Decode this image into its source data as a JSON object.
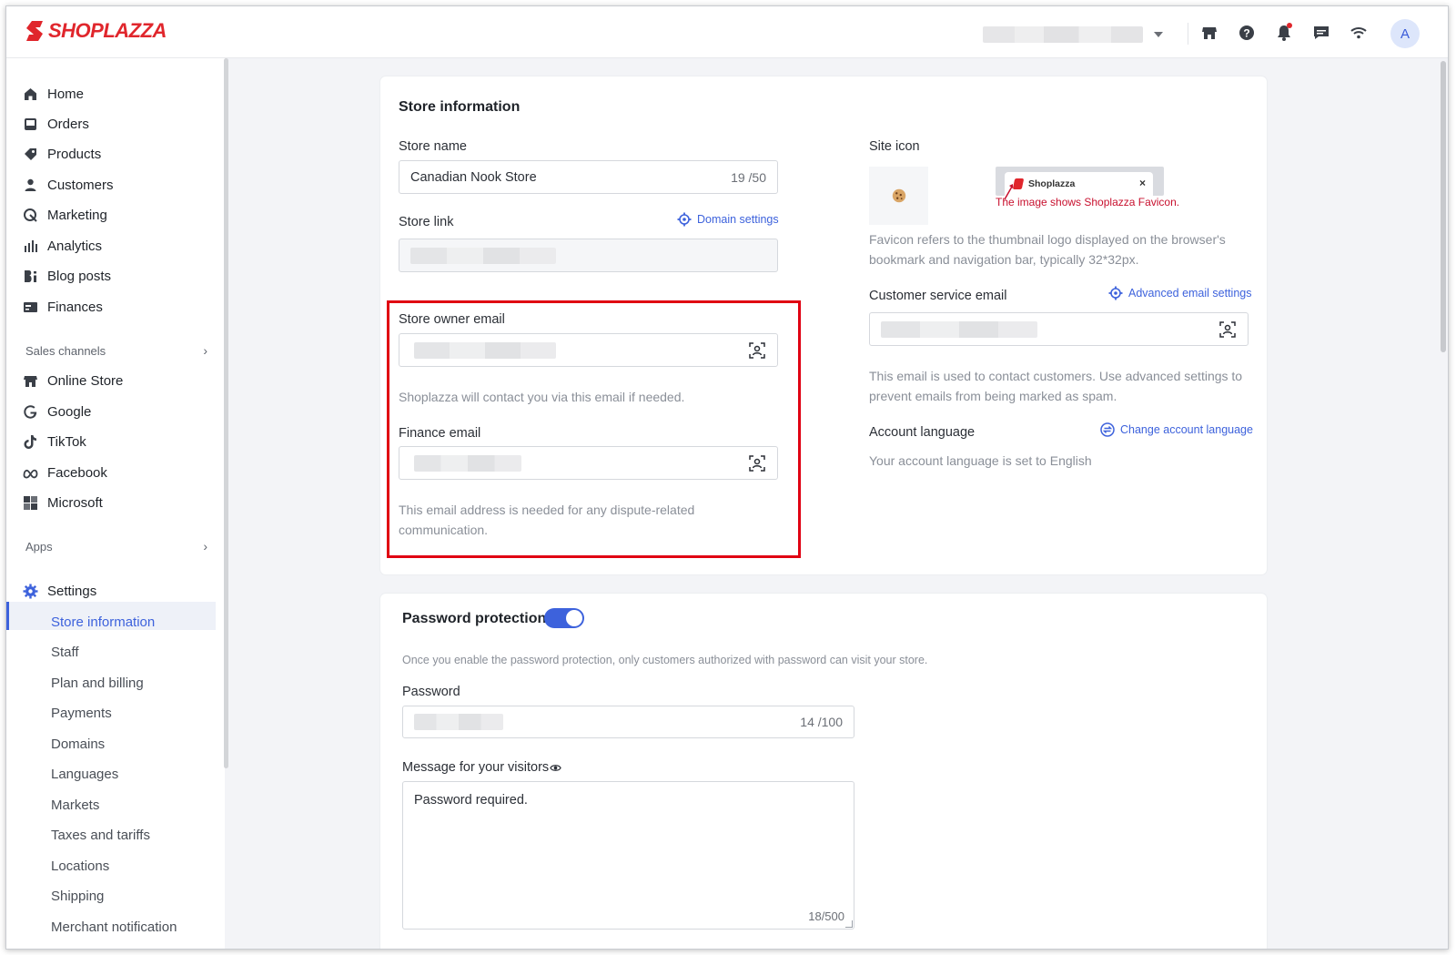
{
  "app": {
    "brand": "SHOPLAZZA",
    "avatar_initial": "A",
    "accent_color": "#3d62dc",
    "brand_color": "#e0262c"
  },
  "topbar": {
    "icons": [
      "storefront-icon",
      "help-icon",
      "bell-icon",
      "chat-icon",
      "wifi-icon"
    ]
  },
  "sidebar": {
    "main": [
      {
        "label": "Home",
        "icon": "home-icon"
      },
      {
        "label": "Orders",
        "icon": "orders-icon"
      },
      {
        "label": "Products",
        "icon": "tag-icon"
      },
      {
        "label": "Customers",
        "icon": "person-icon"
      },
      {
        "label": "Marketing",
        "icon": "marketing-icon"
      },
      {
        "label": "Analytics",
        "icon": "bar-chart-icon"
      },
      {
        "label": "Blog posts",
        "icon": "blog-icon"
      },
      {
        "label": "Finances",
        "icon": "finance-icon"
      }
    ],
    "sales_channels_label": "Sales channels",
    "channels": [
      {
        "label": "Online Store",
        "icon": "storefront-icon"
      },
      {
        "label": "Google",
        "icon": "google-icon"
      },
      {
        "label": "TikTok",
        "icon": "tiktok-icon"
      },
      {
        "label": "Facebook",
        "icon": "meta-icon"
      },
      {
        "label": "Microsoft",
        "icon": "microsoft-icon"
      }
    ],
    "apps_label": "Apps",
    "settings_label": "Settings",
    "settings_items": [
      "Store information",
      "Staff",
      "Plan and billing",
      "Payments",
      "Domains",
      "Languages",
      "Markets",
      "Taxes and tariffs",
      "Locations",
      "Shipping",
      "Merchant notification"
    ],
    "active_item": "Store information"
  },
  "store_info": {
    "title": "Store information",
    "store_name_label": "Store name",
    "store_name_value": "Canadian Nook Store",
    "store_name_counter": "19 /50",
    "store_link_label": "Store link",
    "domain_settings_link": "Domain settings",
    "owner_email_label": "Store owner email",
    "owner_email_help": "Shoplazza will contact you via this email if needed.",
    "finance_email_label": "Finance email",
    "finance_email_help": "This email address is needed for any dispute-related communication.",
    "site_icon_label": "Site icon",
    "tab_preview_title": "Shoplazza",
    "tab_preview_close": "×",
    "annotation": "The image shows Shoplazza Favicon.",
    "favicon_help": "Favicon refers to the thumbnail logo displayed on the browser's bookmark and navigation bar, typically 32*32px.",
    "cs_email_label": "Customer service email",
    "advanced_email_link": "Advanced email settings",
    "cs_email_help": "This email is used to contact customers. Use advanced settings to prevent emails from being marked as spam.",
    "account_language_label": "Account language",
    "change_language_link": "Change account language",
    "account_language_text": "Your account language is set to English"
  },
  "password": {
    "title": "Password protection",
    "enabled": true,
    "description": "Once you enable the password protection, only customers authorized with password can visit your store.",
    "password_label": "Password",
    "password_counter": "14 /100",
    "message_label": "Message for your visitors",
    "message_value": "Password required.",
    "message_counter": "18/500"
  }
}
